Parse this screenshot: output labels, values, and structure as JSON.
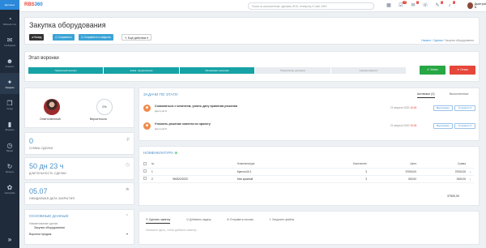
{
  "sidebar": {
    "logo": "Деловые",
    "items": [
      {
        "icon": "chart-pie-icon",
        "glyph": "◔",
        "label": "Рабочий стол"
      },
      {
        "icon": "chat-bubbles-icon",
        "glyph": "✉",
        "label": "Сообщения"
      },
      {
        "icon": "people-icon",
        "glyph": "☻",
        "label": "Клиенты"
      },
      {
        "icon": "cart-icon",
        "glyph": "✦",
        "label": "Продажи"
      },
      {
        "icon": "box-icon",
        "glyph": "❒",
        "label": "Склад"
      },
      {
        "icon": "bar-chart-icon",
        "glyph": "▮",
        "label": "Финансы"
      },
      {
        "icon": "clock-icon",
        "glyph": "◷",
        "label": "Время"
      },
      {
        "icon": "refresh-icon",
        "glyph": "↻",
        "label": "Проекты"
      },
      {
        "icon": "gear-icon",
        "glyph": "✿",
        "label": "Настройки"
      }
    ],
    "expand": "»"
  },
  "topbar": {
    "brand_left": "RBS",
    "brand_right": "360",
    "search_placeholder": "Поиск по контрагентам, сделкам, ИНН, телефону, E-mail, ФИО",
    "icons": [
      {
        "name": "calendar-icon",
        "glyph": "▦",
        "badge": ""
      },
      {
        "name": "tasks-icon",
        "glyph": "☑",
        "badge": "12"
      },
      {
        "name": "mail-icon",
        "glyph": "✉",
        "badge": "3"
      },
      {
        "name": "phone-icon",
        "glyph": "☏",
        "badge": ""
      },
      {
        "name": "chat-icon",
        "glyph": "✎",
        "badge": "5"
      },
      {
        "name": "bell-icon",
        "glyph": "♪",
        "badge": "1"
      }
    ],
    "user_name": "Дмитрий Б."
  },
  "header": {
    "title": "Закупка оборудования",
    "buttons": {
      "back": "◂ Назад",
      "save": "⎙ Сохранить",
      "save_close": "⎙ Сохранить и закрыть",
      "more": "✎ Ещё действия ▾"
    },
    "breadcrumb": {
      "part1": "Начало",
      "sep": " / ",
      "part2": "Сделки",
      "part3": "Закупка оборудования"
    }
  },
  "stage": {
    "title": "Этап воронки",
    "steps": [
      {
        "label": "Первичный контакт",
        "done": true
      },
      {
        "label": "Комм. предложение",
        "done": true
      },
      {
        "label": "Принимают решение",
        "done": true
      },
      {
        "label": "Подписание договора",
        "done": false
      },
      {
        "label": "Сделка закрыта",
        "done": false
      }
    ],
    "won": "✔ Успех",
    "lost": "✕ Отказ"
  },
  "person": {
    "responsible_label": "Ответственный",
    "probability_value": "0%",
    "probability_label": "Вероятность"
  },
  "metrics": [
    {
      "value": "0",
      "label": "СУММА СДЕЛКИ",
      "icon": "money-icon",
      "glyph": "₽"
    },
    {
      "value": "50 дн 23 ч",
      "label": "ДЛИТЕЛЬНОСТЬ СДЕЛКИ",
      "icon": "clock-icon",
      "glyph": "◷"
    },
    {
      "value": "05.07",
      "label": "ОЖИДАЕМАЯ ДАТА ЗАКРЫТИЯ",
      "icon": "flag-icon",
      "glyph": "⚑"
    }
  ],
  "basic": {
    "title": "ОСНОВНЫЕ ДАННЫЕ",
    "toggle": "⌃",
    "name_label": "Наименование сделки",
    "name_value": "Закупка оборудования",
    "funnel_label": "Воронка продаж",
    "funnel_caret": "▾"
  },
  "tasks": {
    "title": "ЗАДАЧИ ПО ЭТАПУ",
    "tab_active": "Активные (2)",
    "tab_done": "Выполненные",
    "items": [
      {
        "title": "Созвониться с клиентом, узнать дату принятия решения",
        "author": "Дмитрий Б.",
        "date": "21 августа 2020",
        "time": "16:45",
        "b1": "Выполнено",
        "b2": "Отложить ▾"
      },
      {
        "title": "Уточнить решение клиента по проекту",
        "author": "Дмитрий Б.",
        "date": "21 августа 2020",
        "time": "16:45",
        "b1": "Выполнено",
        "b2": "Отложить ▾"
      }
    ]
  },
  "items": {
    "title": "НОМЕНКЛАТУРА",
    "add": "⊕",
    "columns": [
      "№",
      "",
      "Номенклатура",
      "Количество",
      "Цена",
      "Сумма"
    ],
    "rows": [
      {
        "n": "1",
        "code": "",
        "name": "Кресло М-3",
        "qty": "3",
        "price": "97000,00",
        "sum": "37000,00"
      },
      {
        "n": "2",
        "code": "980322/2020",
        "name": "Мяч красный",
        "qty": "3",
        "price": "500,00",
        "sum": "1500,00"
      }
    ],
    "total": "37500,00"
  },
  "comments": {
    "tabs": [
      "✎ Сделать заметку",
      "☑ Добавить задачу",
      "✉ Отправить письмо",
      "⇪ Загрузить файлы"
    ],
    "placeholder": "Напишите здесь, чтобы добавить заметку..."
  }
}
